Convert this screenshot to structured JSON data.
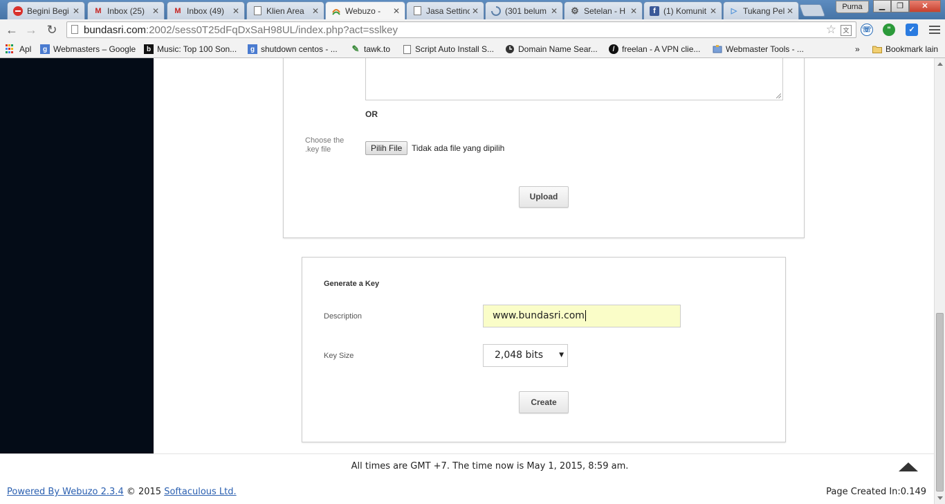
{
  "browser": {
    "tabs": [
      {
        "title": "Begini Begi",
        "icon": "stop-sign-icon",
        "active": false
      },
      {
        "title": "Inbox (25)",
        "icon": "gmail-icon",
        "active": false
      },
      {
        "title": "Inbox (49)",
        "icon": "gmail-icon",
        "active": false
      },
      {
        "title": "Klien Area",
        "icon": "page-icon",
        "active": false
      },
      {
        "title": "Webuzo - ",
        "icon": "webuzo-icon",
        "active": true
      },
      {
        "title": "Jasa Settinc",
        "icon": "page-icon",
        "active": false
      },
      {
        "title": "(301 belum",
        "icon": "loading-icon",
        "active": false
      },
      {
        "title": "Setelan - H",
        "icon": "gear-icon",
        "active": false
      },
      {
        "title": "(1) Komunit",
        "icon": "facebook-icon",
        "active": false
      },
      {
        "title": "Tukang Pel",
        "icon": "play-icon",
        "active": false
      }
    ],
    "profile_name": "Purna",
    "url_host": "bundasri.com",
    "url_rest": ":2002/sess0T25dFqDxSaH98UL/index.php?act=sslkey",
    "bookmarks": [
      {
        "label": "Apl",
        "icon": "apps-grid-icon"
      },
      {
        "label": "Webmasters – Google",
        "icon": "google-icon"
      },
      {
        "label": "Music: Top 100 Son...",
        "icon": "b-icon"
      },
      {
        "label": "shutdown centos - ...",
        "icon": "google-icon"
      },
      {
        "label": "tawk.to",
        "icon": "tawk-icon"
      },
      {
        "label": "Script Auto Install S...",
        "icon": "page-icon"
      },
      {
        "label": "Domain Name Sear...",
        "icon": "clock-icon"
      },
      {
        "label": "freelan - A VPN clie...",
        "icon": "freelan-icon"
      },
      {
        "label": "Webmaster Tools - ...",
        "icon": "webmaster-icon"
      }
    ],
    "bookmarks_overflow": "»",
    "other_bookmarks": "Bookmark lain"
  },
  "upload": {
    "or_label": "OR",
    "choose_label": "Choose the .key file",
    "file_button": "Pilih File",
    "file_status": "Tidak ada file yang dipilih",
    "upload_button": "Upload"
  },
  "generate": {
    "title": "Generate a Key",
    "description_label": "Description",
    "description_value": "www.bundasri.com",
    "key_size_label": "Key Size",
    "key_size_value": "2,048 bits",
    "create_button": "Create"
  },
  "footer": {
    "time_note": "All times are GMT +7. The time now is May 1, 2015, 8:59 am.",
    "powered_prefix": "Powered By Webuzo 2.3.4",
    "powered_middle": " © 2015 ",
    "powered_company": "Softaculous Ltd.",
    "page_created": "Page Created In:0.149"
  },
  "colors": {
    "sidebar": "#040c17",
    "input_highlight": "#fafdc8",
    "link": "#2a5fb0"
  }
}
